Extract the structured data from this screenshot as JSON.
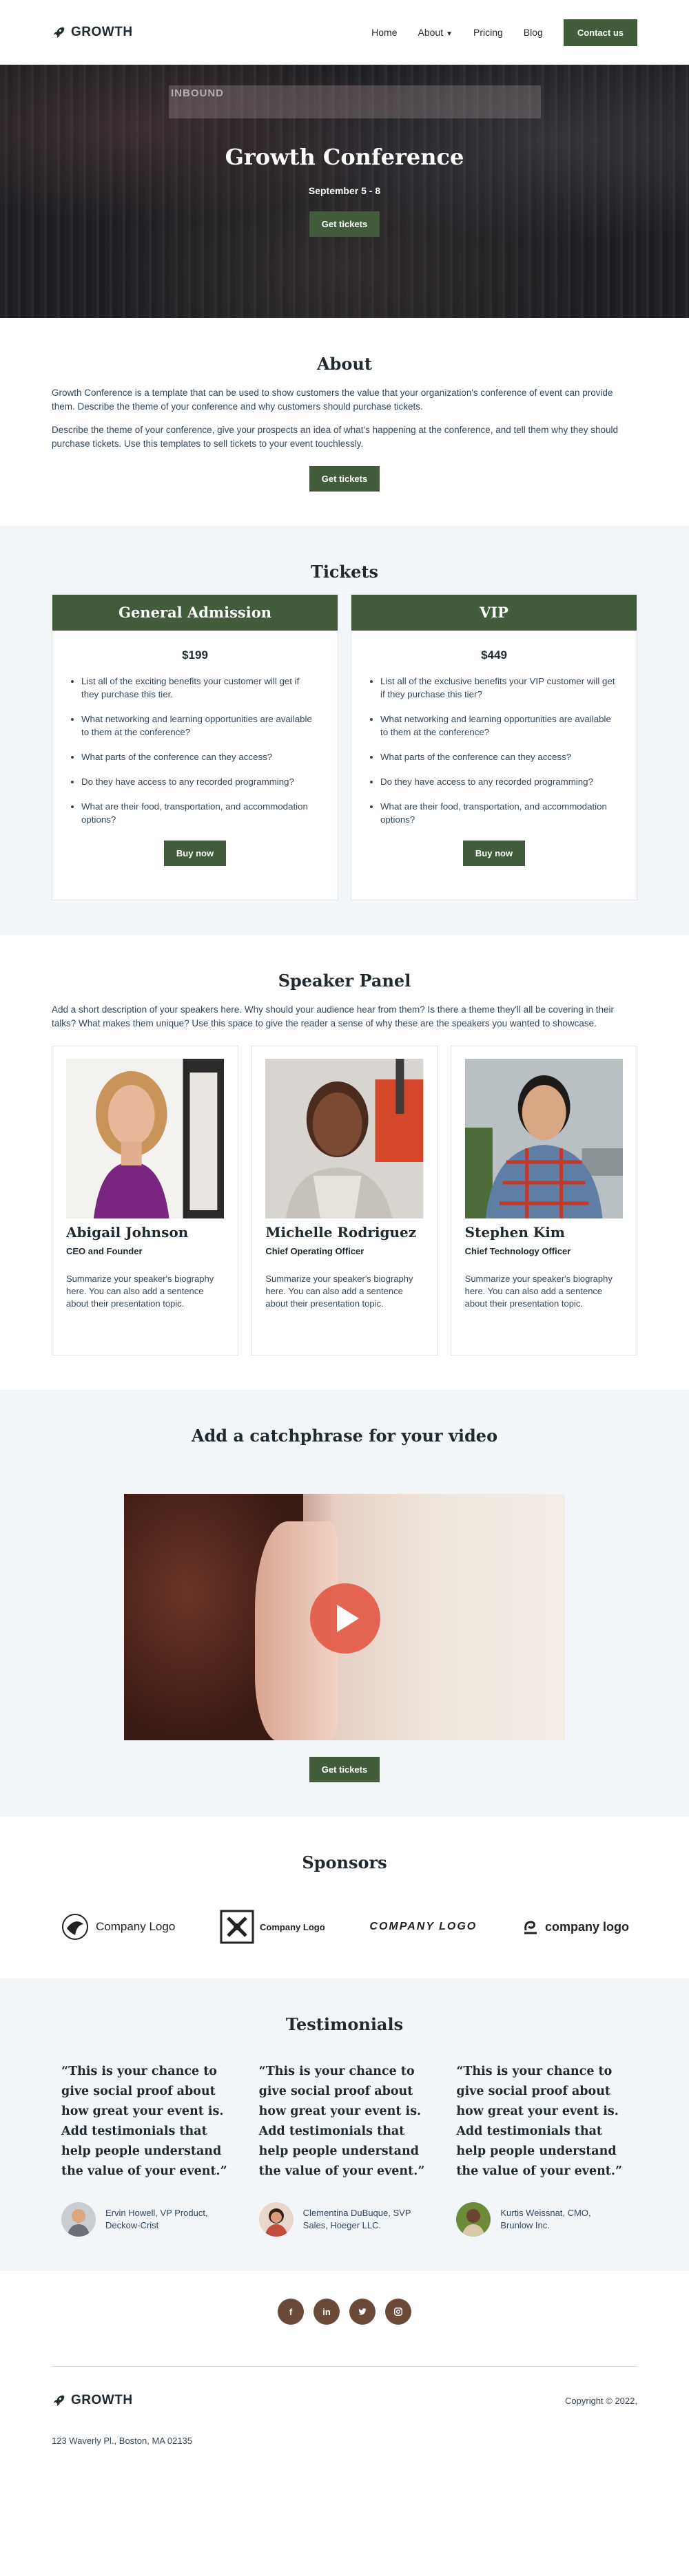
{
  "brand": {
    "name": "GROWTH",
    "accent": "#425b3a",
    "icon": "rocket-icon"
  },
  "nav": {
    "items": [
      "Home",
      "About",
      "Pricing",
      "Blog"
    ],
    "cta": "Contact us"
  },
  "hero": {
    "title": "Growth Conference",
    "date": "September 5 - 8",
    "button": "Get tickets",
    "banner_text": "INBOUND"
  },
  "about": {
    "title": "About",
    "p1": "Growth Conference is a template that can be used to show customers the value that your organization's conference of event can provide them. Describe the theme of your conference and why customers should purchase tickets.",
    "p2": "Describe the theme of your conference, give your prospects an idea of what's happening at the conference, and tell them why they should purchase tickets. Use this templates to sell tickets to your event touchlessly.",
    "button": "Get tickets"
  },
  "tickets": {
    "title": "Tickets",
    "tiers": [
      {
        "name": "General Admission",
        "price": "$199",
        "features": [
          "List all of the exciting benefits your customer will get if they purchase this tier.",
          "What networking and learning opportunities are available to them at the conference?",
          "What parts of the conference can they access?",
          "Do they have access to any recorded programming?",
          "What are their food, transportation, and accommodation options?"
        ],
        "button": "Buy now"
      },
      {
        "name": "VIP",
        "price": "$449",
        "features": [
          "List all of the exclusive benefits your VIP customer will get if they purchase this tier?",
          "What networking and learning opportunities are available to them at the conference?",
          "What parts of the conference can they access?",
          "Do they have access to any recorded programming?",
          "What are their food, transportation, and accommodation options?"
        ],
        "button": "Buy now"
      }
    ]
  },
  "speakers": {
    "title": "Speaker Panel",
    "description": "Add a short description of your speakers here. Why should your audience hear from them? Is there a theme they'll all be covering in their talks? What makes them unique? Use this space to give the reader a sense of why these are the speakers you wanted to showcase.",
    "people": [
      {
        "name": "Abigail Johnson",
        "role": "CEO and Founder",
        "bio": "Summarize your speaker's biography here. You can also add a sentence about their presentation topic."
      },
      {
        "name": "Michelle Rodriguez",
        "role": "Chief Operating Officer",
        "bio": "Summarize your speaker's biography here. You can also add a sentence about their presentation topic."
      },
      {
        "name": "Stephen Kim",
        "role": "Chief Technology Officer",
        "bio": "Summarize your speaker's biography here. You can also add a sentence about their presentation topic."
      }
    ]
  },
  "video": {
    "title": "Add a catchphrase for your video",
    "button": "Get tickets"
  },
  "sponsors": {
    "title": "Sponsors",
    "logos": [
      "Company Logo",
      "Company Logo",
      "COMPANY LOGO",
      "company logo"
    ]
  },
  "testimonials": {
    "title": "Testimonials",
    "items": [
      {
        "quote": "“This is your chance to give social proof about how great your event is. Add testimonials that help people understand the value of your event.”",
        "name": "Ervin Howell, VP Product,",
        "company": "Deckow-Crist"
      },
      {
        "quote": "“This is your chance to give social proof about how great your event is. Add testimonials that help people understand the value of your event.”",
        "name": "Clementina DuBuque, SVP",
        "company": "Sales, Hoeger LLC."
      },
      {
        "quote": "“This is your chance to give social proof about how great your event is. Add testimonials that help people understand the value of your event.”",
        "name": "Kurtis Weissnat, CMO,",
        "company": "Brunlow Inc."
      }
    ]
  },
  "social": [
    "facebook-icon",
    "linkedin-icon",
    "twitter-icon",
    "instagram-icon"
  ],
  "footer": {
    "brand": "GROWTH",
    "copyright": "Copyright © 2022,",
    "address": "123 Waverly Pl., Boston, MA 02135"
  }
}
